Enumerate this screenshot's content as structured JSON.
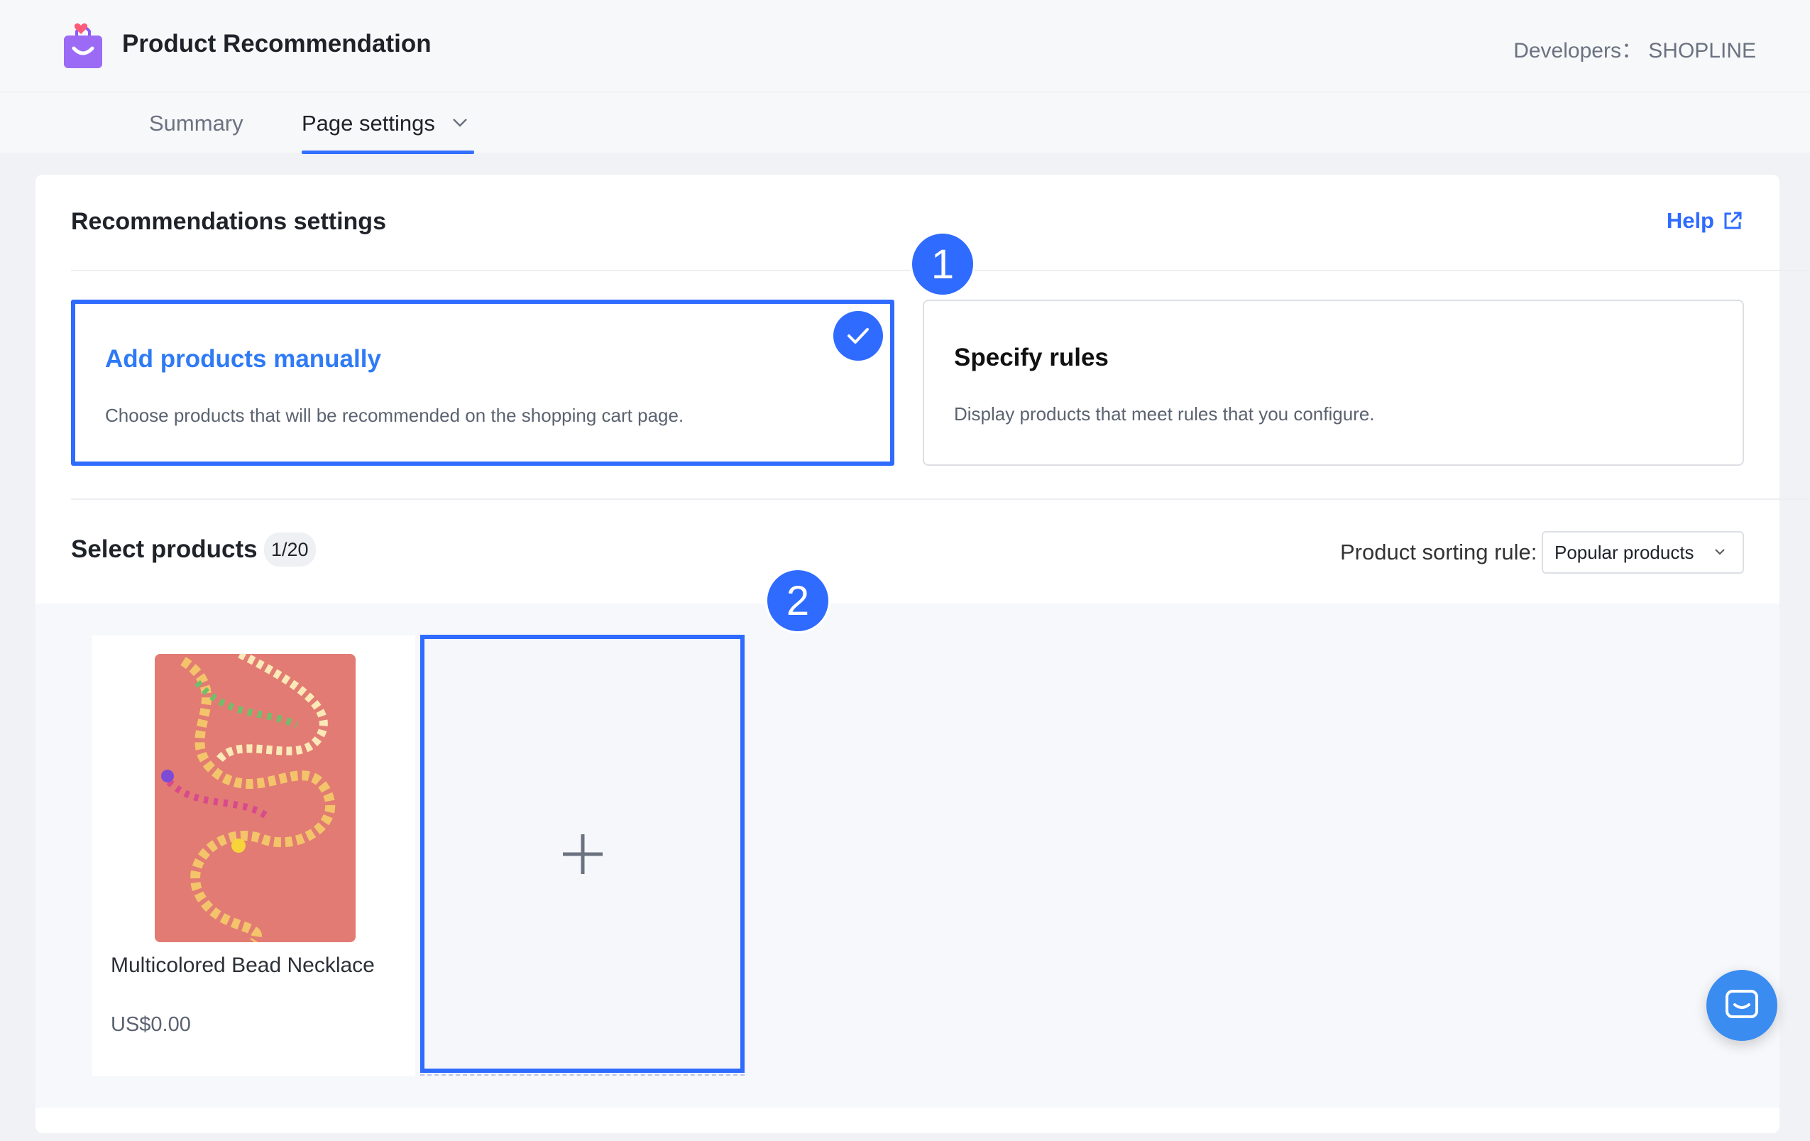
{
  "header": {
    "app_title": "Product Recommendation",
    "developer": "Developers： SHOPLINE"
  },
  "tabs": [
    {
      "label": "Summary"
    },
    {
      "label": "Page settings"
    }
  ],
  "settings": {
    "title": "Recommendations settings",
    "help_label": "Help",
    "options": [
      {
        "title": "Add products manually",
        "description": "Choose products that will be recommended on the shopping cart page.",
        "selected": true
      },
      {
        "title": "Specify rules",
        "description": "Display products that meet rules that you configure.",
        "selected": false
      }
    ]
  },
  "annotations": {
    "step1": "1",
    "step2": "2"
  },
  "select_products": {
    "title": "Select products",
    "count": "1/20",
    "sort_label": "Product sorting rule:",
    "sort_value": "Popular products"
  },
  "products": [
    {
      "name": "Multicolored Bead Necklace",
      "price": "US$0.00"
    }
  ],
  "colors": {
    "accent": "#2f6bff",
    "link": "#2f7af5"
  }
}
